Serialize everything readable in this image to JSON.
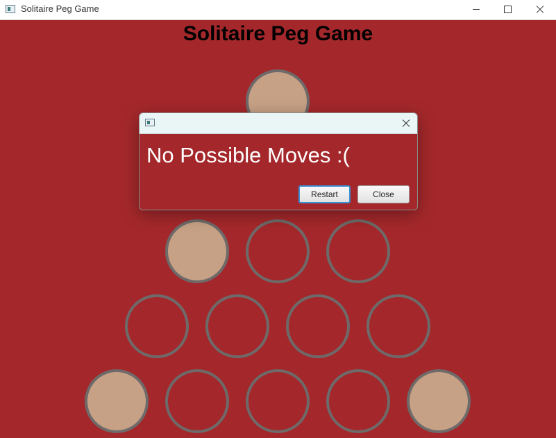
{
  "window": {
    "title": "Solitaire Peg Game"
  },
  "game": {
    "title": "Solitaire Peg Game",
    "board": [
      [
        true
      ],
      [
        false,
        false
      ],
      [
        true,
        false,
        false
      ],
      [
        false,
        false,
        false,
        false
      ],
      [
        true,
        false,
        false,
        false,
        true
      ]
    ]
  },
  "dialog": {
    "message": "No Possible Moves :(",
    "restart_label": "Restart",
    "close_label": "Close"
  },
  "colors": {
    "background": "#a4282b",
    "peg": "#c6a185",
    "hole_border": "#6e6a6a"
  }
}
